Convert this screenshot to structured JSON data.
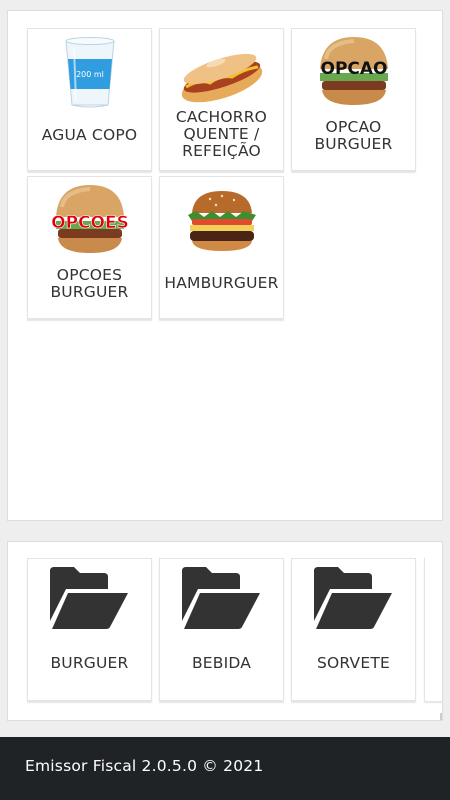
{
  "products": [
    {
      "label": "AGUA COPO",
      "icon": "water-cup-icon",
      "cup_text": "200 ml"
    },
    {
      "label": "CACHORRO\nQUENTE /\nREFEIÇÃO",
      "icon": "hot-dog-icon"
    },
    {
      "label": "OPCAO\nBURGUER",
      "icon": "burger-icon",
      "overlay": "OPCAO"
    },
    {
      "label": "OPCOES\nBURGUER",
      "icon": "burger-icon",
      "overlay": "OPCOES"
    },
    {
      "label": "HAMBURGUER",
      "icon": "hamburger-icon"
    }
  ],
  "categories": [
    {
      "label": "BURGUER",
      "icon": "folder-open-icon"
    },
    {
      "label": "BEBIDA",
      "icon": "folder-open-icon"
    },
    {
      "label": "SORVETE",
      "icon": "folder-open-icon"
    }
  ],
  "footer": {
    "text": "Emissor Fiscal 2.0.5.0 © 2021"
  },
  "colors": {
    "overlay_black": "#111111",
    "overlay_red": "#e0000b",
    "footer_bg": "#202326",
    "folder": "#333333"
  }
}
